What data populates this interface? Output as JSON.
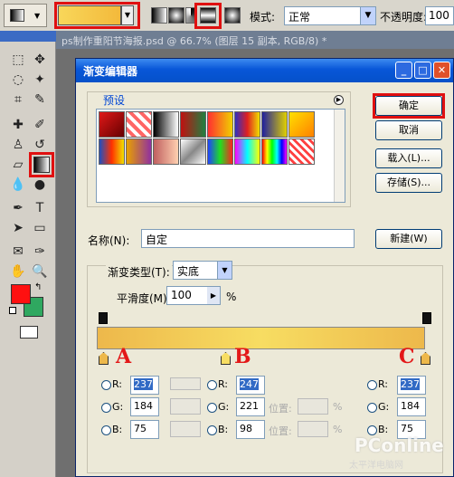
{
  "options_bar": {
    "mode_label": "模式:",
    "mode_value": "正常",
    "opacity_label": "不透明度:",
    "opacity_value": "100"
  },
  "document": {
    "title": "ps制作重阳节海报.psd @ 66.7% (图层 15 副本, RGB/8) *"
  },
  "dialog": {
    "title": "渐变编辑器",
    "presets_label": "预设",
    "buttons": {
      "ok": "确定",
      "cancel": "取消",
      "load": "载入(L)...",
      "save": "存储(S)...",
      "new": "新建(W)"
    },
    "name_label": "名称(N):",
    "name_value": "自定",
    "gradient_type_label": "渐变类型(T):",
    "gradient_type_value": "实底",
    "smoothness_label": "平滑度(M):",
    "smoothness_value": "100",
    "smoothness_unit": "%",
    "presets": [
      "#e01818",
      "#e83030",
      "#000000",
      "#b01010",
      "#ff3030",
      "#3030c0",
      "#2020a0",
      "#ffe000",
      "#2050c0",
      "#e8a000",
      "#c06060",
      "#d0d0d0",
      "#2040ff",
      "#ff00ff",
      "#20e020",
      "#ff4040"
    ]
  },
  "color_stops": {
    "stop_a": {
      "label": "A",
      "r": "237",
      "g": "184",
      "b": "75"
    },
    "stop_b": {
      "label": "B",
      "r": "247",
      "g": "221",
      "b": "98",
      "location_label": "位置:",
      "pct": "%"
    },
    "stop_c": {
      "label": "C",
      "r": "237",
      "g": "184",
      "b": "75"
    }
  },
  "channel_labels": {
    "r": "R:",
    "g": "G:",
    "b": "B:"
  },
  "watermark": {
    "main": "PConline",
    "sub": "太平洋电脑网"
  },
  "colors": {
    "foreground": "#ff1010",
    "background": "#2fa860",
    "gradient_start": "#edb84b",
    "gradient_mid": "#f7dd62",
    "highlight": "#e01010"
  }
}
